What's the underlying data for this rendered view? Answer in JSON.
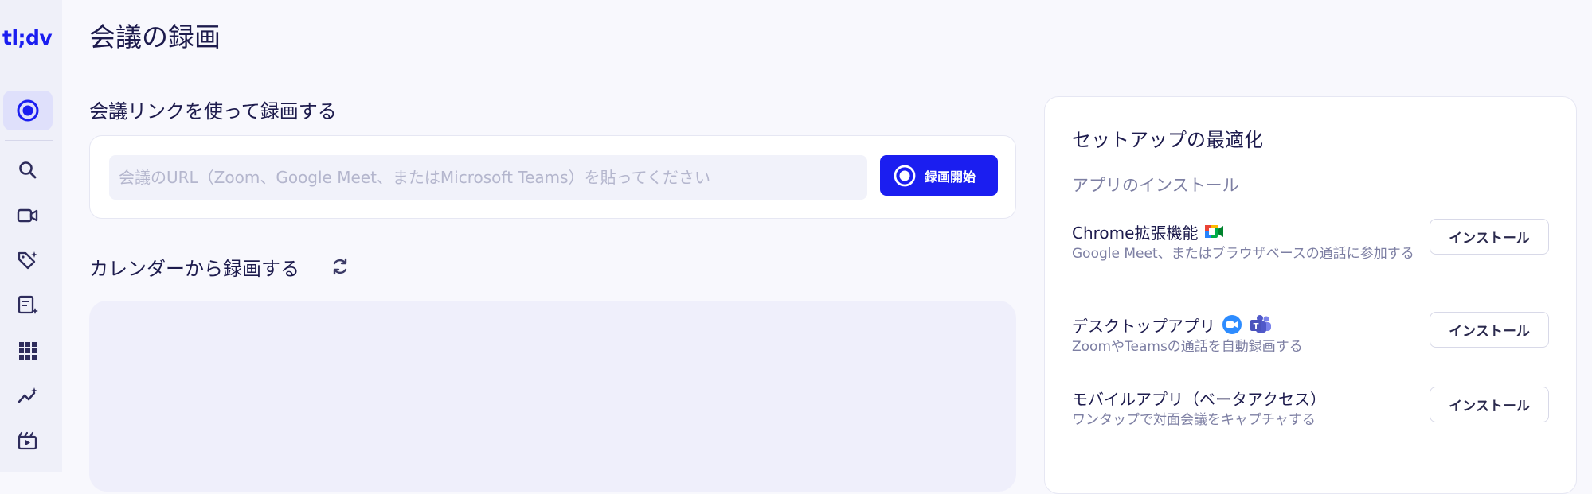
{
  "app": {
    "logo": "tl;dv"
  },
  "sidebar": {
    "items": [
      {
        "icon": "record-icon",
        "active": true
      },
      {
        "icon": "search-icon"
      },
      {
        "icon": "video-icon"
      },
      {
        "icon": "tag-sparkle-icon"
      },
      {
        "icon": "notes-icon"
      },
      {
        "icon": "apps-grid-icon"
      },
      {
        "icon": "analytics-icon"
      },
      {
        "icon": "clips-icon"
      }
    ]
  },
  "main": {
    "page_title": "会議の録画",
    "link_section_title": "会議リンクを使って録画する",
    "url_placeholder": "会議のURL（Zoom、Google Meet、またはMicrosoft Teams）を貼ってください",
    "url_value": "",
    "record_button_label": "録画開始",
    "calendar_section_title": "カレンダーから録画する"
  },
  "setup": {
    "title": "セットアップの最適化",
    "subtitle": "アプリのインストール",
    "apps": [
      {
        "name": "Chrome拡張機能",
        "icons": [
          "google-meet-icon"
        ],
        "description": "Google Meet、またはブラウザベースの通話に参加する",
        "button_label": "インストール"
      },
      {
        "name": "デスクトップアプリ",
        "icons": [
          "zoom-icon",
          "teams-icon"
        ],
        "description": "ZoomやTeamsの通話を自動録画する",
        "button_label": "インストール"
      },
      {
        "name": "モバイルアプリ（ベータアクセス）",
        "icons": [],
        "description": "ワンタップで対面会議をキャプチャする",
        "button_label": "インストール"
      }
    ]
  },
  "colors": {
    "brand": "#1b1ef0",
    "text": "#1d1b4d",
    "muted": "#7d7fa3",
    "sidebar_bg": "#eff0f9",
    "page_bg": "#f8f8fd"
  }
}
